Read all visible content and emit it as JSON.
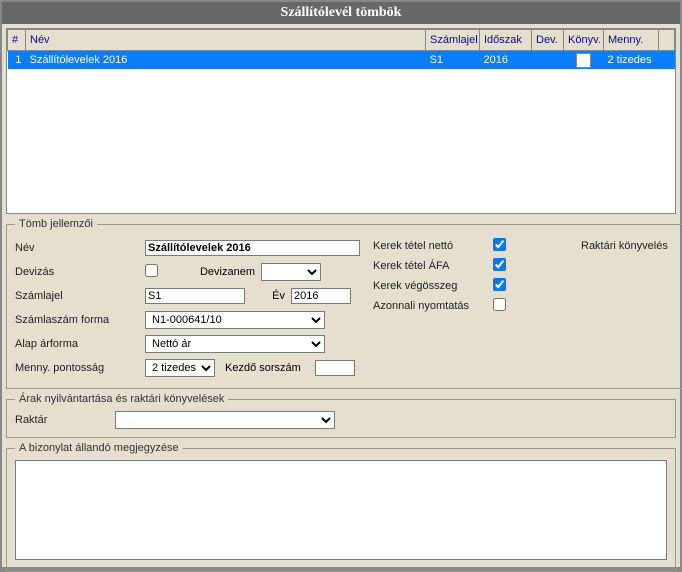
{
  "title": "Szállítólevél tömbök",
  "table": {
    "headers": {
      "num": "#",
      "nev": "Név",
      "szamlajel": "Számlajel",
      "idoszak": "Időszak",
      "dev": "Dev.",
      "konyv": "Könyv.",
      "menny": "Menny."
    },
    "rows": [
      {
        "num": "1",
        "nev": "Szállítólevelek 2016",
        "szamlajel": "S1",
        "idoszak": "2016",
        "dev": "",
        "konyv_checked": false,
        "menny": "2 tizedes"
      }
    ]
  },
  "group_labels": {
    "tomb": "Tömb jellemzői",
    "arak": "Árak nyilvántartása és raktári könyvelések",
    "megj": "A bizonylat állandó megjegyzése"
  },
  "form": {
    "nev_label": "Név",
    "nev_value": "Szállítólevelek 2016",
    "devizas_label": "Devizás",
    "devizas_checked": false,
    "devizanem_label": "Devizanem",
    "devizanem_value": "",
    "szamlajel_label": "Számlajel",
    "szamlajel_value": "S1",
    "ev_label": "Év",
    "ev_value": "2016",
    "szamlaszam_forma_label": "Számlaszám forma",
    "szamlaszam_forma_value": "N1-000641/10",
    "alap_arforma_label": "Alap árforma",
    "alap_arforma_value": "Nettó ár",
    "menny_pontossag_label": "Menny. pontosság",
    "menny_pontossag_value": "2 tizedes",
    "kezdo_sorszam_label": "Kezdő sorszám",
    "kezdo_sorszam_value": "",
    "kerek_tetel_netto_label": "Kerek tétel nettó",
    "kerek_tetel_netto_checked": true,
    "kerek_tetel_afa_label": "Kerek tétel ÁFA",
    "kerek_tetel_afa_checked": true,
    "kerek_vegosszeg_label": "Kerek végösszeg",
    "kerek_vegosszeg_checked": true,
    "azonnali_nyomtatas_label": "Azonnali nyomtatás",
    "azonnali_nyomtatas_checked": false,
    "raktari_konyveles_label": "Raktári könyvelés",
    "raktari_konyveles_checked": false
  },
  "raktar": {
    "label": "Raktár",
    "value": ""
  },
  "megjegyzes": ""
}
